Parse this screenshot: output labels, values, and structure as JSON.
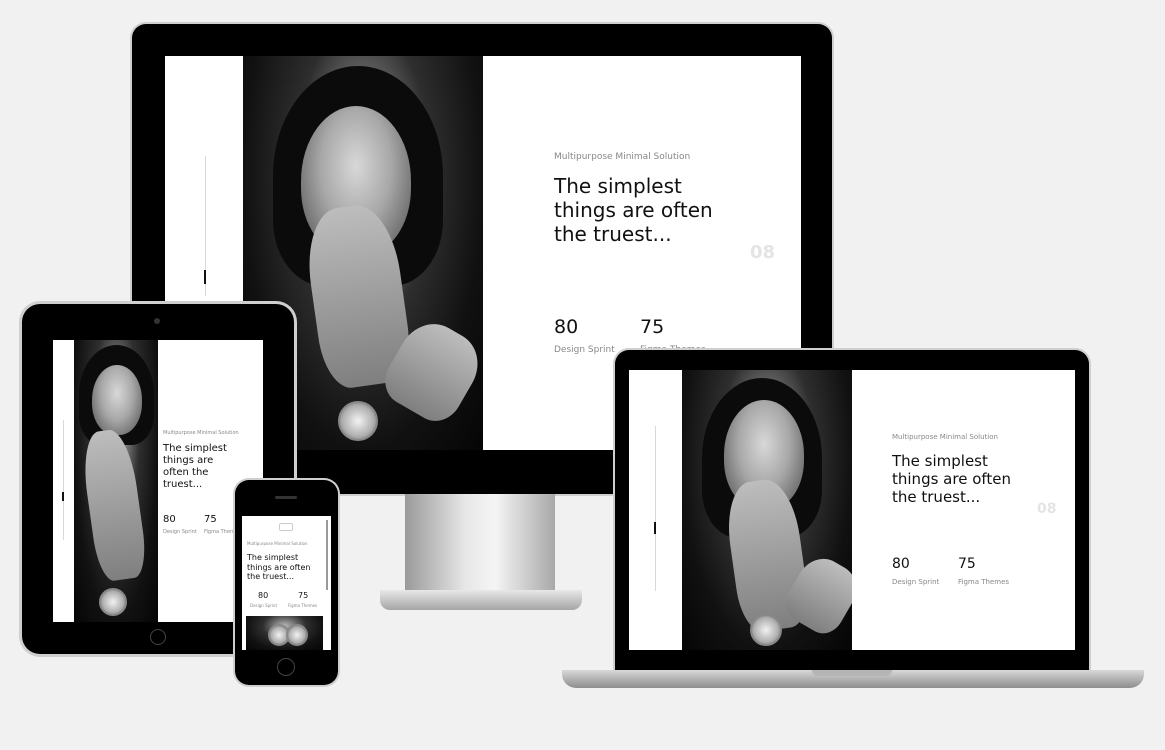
{
  "hero": {
    "eyebrow": "Multipurpose Minimal Solution",
    "headline_line1": "The simplest",
    "headline_line2": "things are often",
    "headline_line3": "the truest...",
    "slide_number": "08",
    "stat1_value": "80",
    "stat1_label": "Design Sprint",
    "stat2_value": "75",
    "stat2_label": "Figma Themes"
  },
  "tablet": {
    "headline_line1": "The simplest",
    "headline_line2": "things are",
    "headline_line3": "often the",
    "headline_line4": "truest..."
  },
  "phone": {
    "headline_line1": "The simplest",
    "headline_line2": "things are often",
    "headline_line3": "the truest..."
  }
}
